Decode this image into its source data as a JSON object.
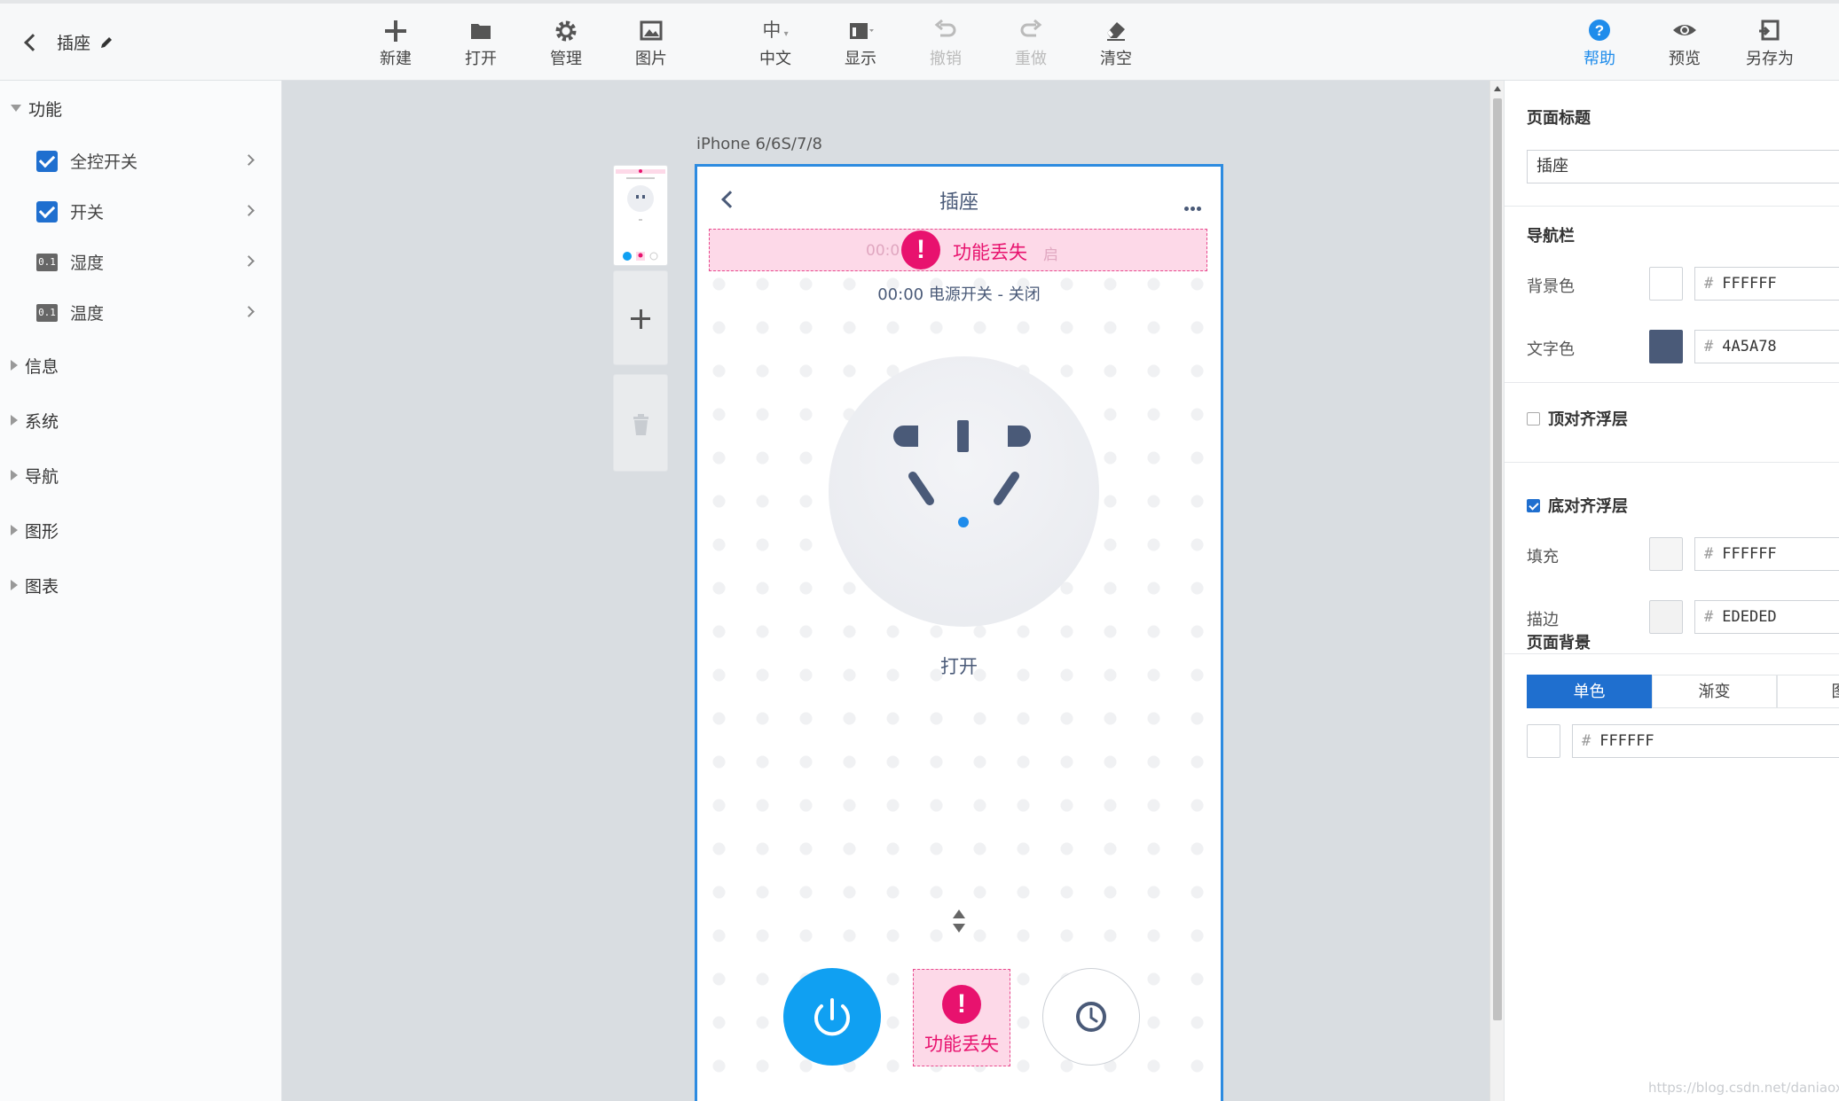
{
  "toolbar": {
    "doc_title": "插座",
    "buttons": {
      "new": "新建",
      "open": "打开",
      "manage": "管理",
      "image": "图片",
      "lang": "中文",
      "lang_icon_char": "中",
      "display": "显示",
      "undo": "撤销",
      "redo": "重做",
      "clear": "清空",
      "help": "帮助",
      "preview": "预览",
      "save_as": "另存为"
    }
  },
  "sidebar": {
    "sections": [
      {
        "label": "功能",
        "expanded": true
      },
      {
        "label": "信息",
        "expanded": false
      },
      {
        "label": "系统",
        "expanded": false
      },
      {
        "label": "导航",
        "expanded": false
      },
      {
        "label": "图形",
        "expanded": false
      },
      {
        "label": "图表",
        "expanded": false
      }
    ],
    "items": [
      {
        "label": "全控开关",
        "icon": "checkbox-checked"
      },
      {
        "label": "开关",
        "icon": "checkbox-checked"
      },
      {
        "label": "湿度",
        "icon": "number-badge",
        "badge": "0.1"
      },
      {
        "label": "温度",
        "icon": "number-badge",
        "badge": "0.1"
      }
    ]
  },
  "canvas": {
    "device_label": "iPhone 6/6S/7/8",
    "phone": {
      "nav_title": "插座",
      "lost_text": "功能丢失",
      "ghost_left": "00:0",
      "ghost_right": "启",
      "status_text": "00:00 电源开关 - 关闭",
      "open_label": "打开",
      "lost_box_text": "功能丢失"
    }
  },
  "panel": {
    "page_title_heading": "页面标题",
    "page_title_value": "插座",
    "navbar_heading": "导航栏",
    "bg_color_label": "背景色",
    "bg_color_hex": "FFFFFF",
    "text_color_label": "文字色",
    "text_color_hex": "4A5A78",
    "top_float_label": "顶对齐浮层",
    "top_float_checked": false,
    "bottom_float_label": "底对齐浮层",
    "bottom_float_checked": true,
    "fill_label": "填充",
    "fill_hex": "FFFFFF",
    "stroke_label": "描边",
    "stroke_hex": "EDEDED",
    "page_bg_heading": "页面背景",
    "bg_tabs": [
      "单色",
      "渐变",
      "图"
    ],
    "page_bg_hex": "FFFFFF",
    "hash": "#"
  },
  "colors": {
    "accent": "#1f6fcf",
    "help_blue": "#1f8ceb",
    "lost_pink": "#e8126e",
    "nav_text": "#4A5A78",
    "power_blue": "#10a0f2"
  },
  "watermark": "https://blog.csdn.net/daniaoxp"
}
